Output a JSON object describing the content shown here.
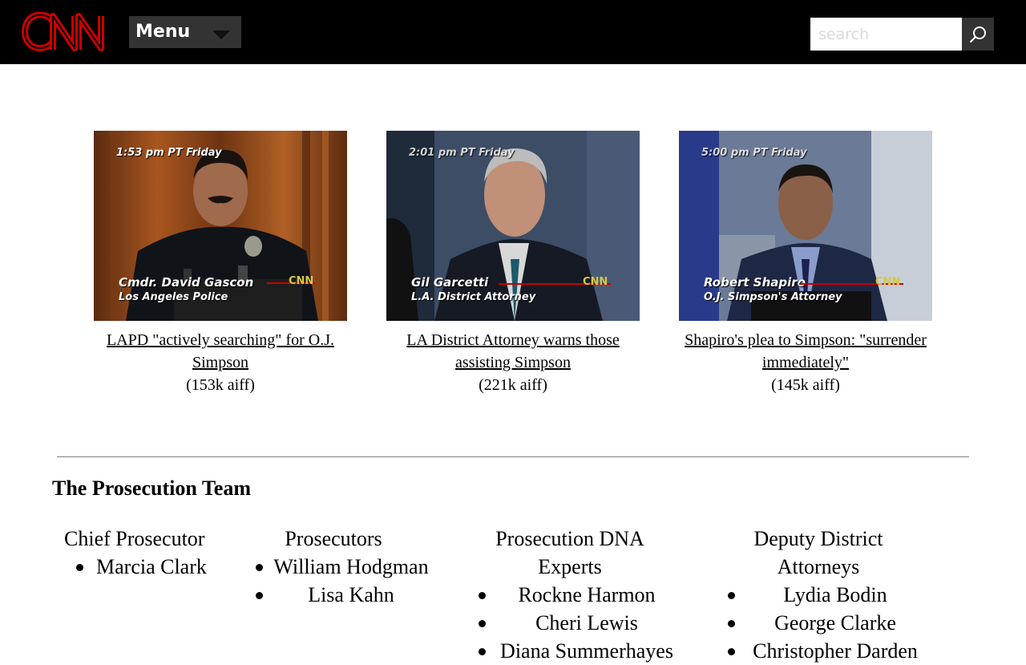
{
  "header": {
    "logo_text": "CNN",
    "menu_label": "Menu",
    "search_placeholder": "search",
    "colors": {
      "bar": "#000000",
      "logo": "#cc0000",
      "menu": "#333333"
    }
  },
  "videos": [
    {
      "overlay_time": "1:53 pm PT Friday",
      "overlay_name": "Cmdr. David Gascon",
      "overlay_title": "Los Angeles Police",
      "caption": "LAPD \"actively searching\" for O.J. Simpson",
      "size": "(153k aiff)"
    },
    {
      "overlay_time": "2:01 pm PT Friday",
      "overlay_name": "Gil Garcetti",
      "overlay_title": "L.A. District Attorney",
      "caption": "LA District Attorney warns those assisting Simpson",
      "size": "(221k aiff)"
    },
    {
      "overlay_time": "5:00 pm PT Friday",
      "overlay_name": "Robert Shapiro",
      "overlay_title": "O.J. Simpson's Attorney",
      "caption": "Shapiro's plea to Simpson: \"surrender immediately\"",
      "size": "(145k aiff)"
    }
  ],
  "team": {
    "title": "The Prosecution Team",
    "columns": [
      {
        "heading": "Chief Prosecutor",
        "members": [
          "Marcia Clark"
        ]
      },
      {
        "heading": "Prosecutors",
        "members": [
          "William Hodgman",
          "Lisa Kahn"
        ]
      },
      {
        "heading": "Prosecution DNA Experts",
        "members": [
          "Rockne Harmon",
          "Cheri Lewis",
          "Diana Summerhayes"
        ]
      },
      {
        "heading": "Deputy District Attorneys",
        "members": [
          "Lydia Bodin",
          "George Clarke",
          "Christopher Darden"
        ]
      }
    ]
  }
}
